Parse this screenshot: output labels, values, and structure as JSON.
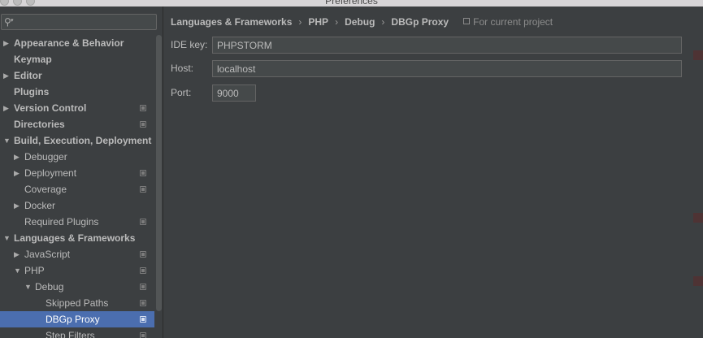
{
  "window": {
    "title": "Preferences"
  },
  "sidebar": {
    "search": {
      "value": "",
      "placeholder": ""
    },
    "items": [
      {
        "label": "Appearance & Behavior",
        "level": 0,
        "arrow": "▶",
        "bold": true,
        "project": false,
        "selected": false
      },
      {
        "label": "Keymap",
        "level": 0,
        "arrow": "",
        "bold": true,
        "project": false,
        "selected": false
      },
      {
        "label": "Editor",
        "level": 0,
        "arrow": "▶",
        "bold": true,
        "project": false,
        "selected": false
      },
      {
        "label": "Plugins",
        "level": 0,
        "arrow": "",
        "bold": true,
        "project": false,
        "selected": false
      },
      {
        "label": "Version Control",
        "level": 0,
        "arrow": "▶",
        "bold": true,
        "project": true,
        "selected": false
      },
      {
        "label": "Directories",
        "level": 0,
        "arrow": "",
        "bold": true,
        "project": true,
        "selected": false
      },
      {
        "label": "Build, Execution, Deployment",
        "level": 0,
        "arrow": "▼",
        "bold": true,
        "project": false,
        "selected": false
      },
      {
        "label": "Debugger",
        "level": 1,
        "arrow": "▶",
        "bold": false,
        "project": false,
        "selected": false
      },
      {
        "label": "Deployment",
        "level": 1,
        "arrow": "▶",
        "bold": false,
        "project": true,
        "selected": false
      },
      {
        "label": "Coverage",
        "level": 1,
        "arrow": "",
        "bold": false,
        "project": true,
        "selected": false
      },
      {
        "label": "Docker",
        "level": 1,
        "arrow": "▶",
        "bold": false,
        "project": false,
        "selected": false
      },
      {
        "label": "Required Plugins",
        "level": 1,
        "arrow": "",
        "bold": false,
        "project": true,
        "selected": false
      },
      {
        "label": "Languages & Frameworks",
        "level": 0,
        "arrow": "▼",
        "bold": true,
        "project": false,
        "selected": false
      },
      {
        "label": "JavaScript",
        "level": 1,
        "arrow": "▶",
        "bold": false,
        "project": true,
        "selected": false
      },
      {
        "label": "PHP",
        "level": 1,
        "arrow": "▼",
        "bold": false,
        "project": true,
        "selected": false
      },
      {
        "label": "Debug",
        "level": 2,
        "arrow": "▼",
        "bold": false,
        "project": true,
        "selected": false
      },
      {
        "label": "Skipped Paths",
        "level": 3,
        "arrow": "",
        "bold": false,
        "project": true,
        "selected": false
      },
      {
        "label": "DBGp Proxy",
        "level": 3,
        "arrow": "",
        "bold": false,
        "project": true,
        "selected": true
      },
      {
        "label": "Step Filters",
        "level": 3,
        "arrow": "",
        "bold": false,
        "project": true,
        "selected": false
      }
    ]
  },
  "breadcrumb": {
    "parts": [
      "Languages & Frameworks",
      "PHP",
      "Debug",
      "DBGp Proxy"
    ],
    "separator": "›",
    "scope": "For current project"
  },
  "form": {
    "ide_key": {
      "label": "IDE key:",
      "value": "PHPSTORM"
    },
    "host": {
      "label": "Host:",
      "value": "localhost"
    },
    "port": {
      "label": "Port:",
      "value": "9000"
    }
  }
}
